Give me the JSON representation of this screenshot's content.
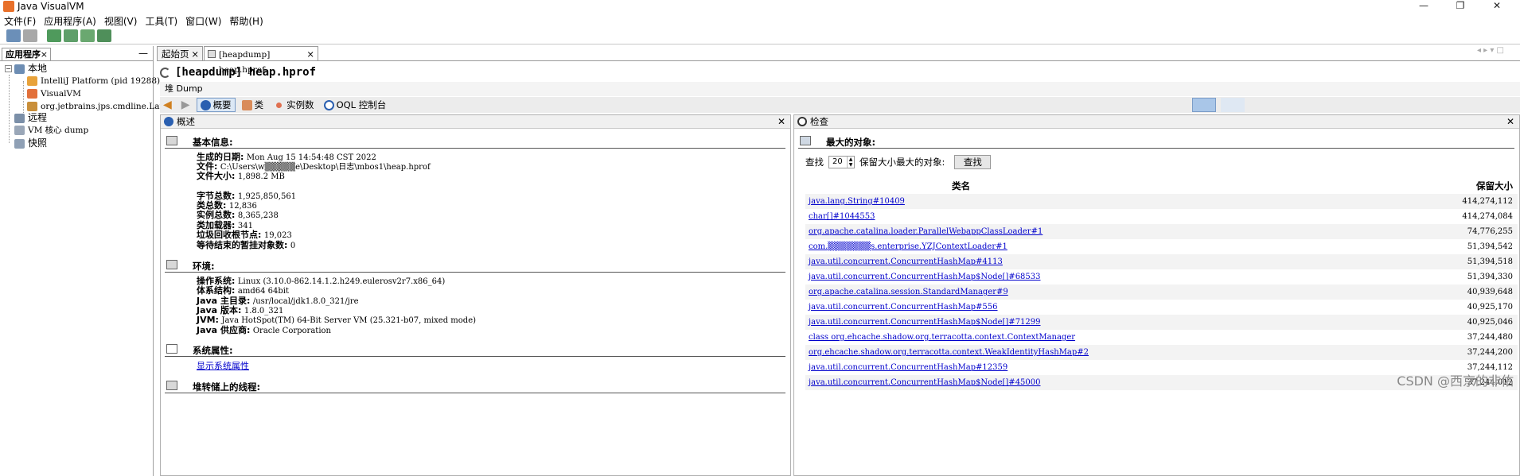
{
  "window": {
    "title": "Java VisualVM",
    "controls": [
      "—",
      "❐",
      "✕"
    ]
  },
  "menu": [
    "文件(F)",
    "应用程序(A)",
    "视图(V)",
    "工具(T)",
    "窗口(W)",
    "帮助(H)"
  ],
  "left_panel": {
    "tab_label": "应用程序",
    "close": "×",
    "minimize": "—",
    "tree": {
      "local": "本地",
      "local_children": [
        "IntelliJ Platform (pid 19288)",
        "VisualVM",
        "org.jetbrains.jps.cmdline.Launcher"
      ],
      "remote": "远程",
      "vm_core": "VM 核心 dump",
      "snapshots": "快照"
    }
  },
  "doc_tabs": {
    "start": "起始页",
    "heap": "[heapdump] heap.hprof",
    "close": "×"
  },
  "heap": {
    "title": "[heapdump] heap.hprof",
    "dump_bar": "堆 Dump",
    "views": {
      "summary": "概要",
      "classes": "类",
      "instances": "实例数",
      "oql": "OQL 控制台"
    }
  },
  "overview": {
    "header": "概述",
    "basic": {
      "title": "基本信息:",
      "rows": [
        {
          "k": "生成的日期:",
          "v": "Mon Aug 15 14:54:48 CST 2022"
        },
        {
          "k": "文件:",
          "v": "C:\\Users\\w▒▒▒▒▒e\\Desktop\\日志\\mbos1\\heap.hprof"
        },
        {
          "k": "文件大小:",
          "v": "1,898.2 MB"
        },
        {
          "k": "字节总数:",
          "v": "1,925,850,561"
        },
        {
          "k": "类总数:",
          "v": "12,836"
        },
        {
          "k": "实例总数:",
          "v": "8,365,238"
        },
        {
          "k": "类加载器:",
          "v": "341"
        },
        {
          "k": "垃圾回收根节点:",
          "v": "19,023"
        },
        {
          "k": "等待结束的暂挂对象数:",
          "v": "0"
        }
      ]
    },
    "env": {
      "title": "环境:",
      "rows": [
        {
          "k": "操作系统:",
          "v": "Linux (3.10.0-862.14.1.2.h249.eulerosv2r7.x86_64)"
        },
        {
          "k": "体系结构:",
          "v": "amd64 64bit"
        },
        {
          "k": "Java 主目录:",
          "v": "/usr/local/jdk1.8.0_321/jre"
        },
        {
          "k": "Java 版本:",
          "v": "1.8.0_321"
        },
        {
          "k": "JVM:",
          "v": "Java HotSpot(TM) 64-Bit Server VM (25.321-b07, mixed mode)"
        },
        {
          "k": "Java 供应商:",
          "v": "Oracle Corporation"
        }
      ]
    },
    "sysprops": {
      "title": "系统属性:",
      "link": "显示系统属性"
    },
    "threads": {
      "title": "堆转储上的线程:"
    }
  },
  "inspect": {
    "header": "检查",
    "title": "最大的对象:",
    "find_label": "查找",
    "count": "20",
    "suffix": "保留大小最大的对象:",
    "button": "查找",
    "col_class": "类名",
    "col_size": "保留大小",
    "rows": [
      {
        "name": "java.lang.String#10409",
        "size": "414,274,112"
      },
      {
        "name": "char[]#1044553",
        "size": "414,274,084"
      },
      {
        "name": "org.apache.catalina.loader.ParallelWebappClassLoader#1",
        "size": "74,776,255"
      },
      {
        "name": "com.▒▒▒▒▒▒▒s.enterprise.YZJContextLoader#1",
        "size": "51,394,542"
      },
      {
        "name": "java.util.concurrent.ConcurrentHashMap#4113",
        "size": "51,394,518"
      },
      {
        "name": "java.util.concurrent.ConcurrentHashMap$Node[]#68533",
        "size": "51,394,330"
      },
      {
        "name": "org.apache.catalina.session.StandardManager#9",
        "size": "40,939,648"
      },
      {
        "name": "java.util.concurrent.ConcurrentHashMap#556",
        "size": "40,925,170"
      },
      {
        "name": "java.util.concurrent.ConcurrentHashMap$Node[]#71299",
        "size": "40,925,046"
      },
      {
        "name": "class org.ehcache.shadow.org.terracotta.context.ContextManager",
        "size": "37,244,480"
      },
      {
        "name": "org.ehcache.shadow.org.terracotta.context.WeakIdentityHashMap#2",
        "size": "37,244,200"
      },
      {
        "name": "java.util.concurrent.ConcurrentHashMap#12359",
        "size": "37,244,112"
      },
      {
        "name": "java.util.concurrent.ConcurrentHashMap$Node[]#45000",
        "size": "37,244,012"
      }
    ]
  },
  "watermark": "CSDN @西京的非佑",
  "colors": {
    "accent": "#1f5fbf",
    "link": "#0000cc",
    "selected": "#dce8f5"
  }
}
